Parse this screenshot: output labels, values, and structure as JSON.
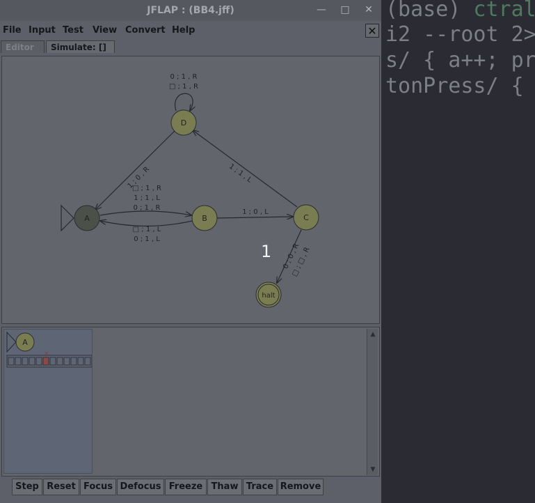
{
  "window": {
    "title": "JFLAP : (BB4.jff)",
    "minimize_glyph": "—",
    "maximize_glyph": "□",
    "close_glyph": "✕"
  },
  "menu": [
    "File",
    "Input",
    "Test",
    "View",
    "Convert",
    "Help"
  ],
  "doc_close_glyph": "✕",
  "tabs": [
    "Editor",
    "Simulate: []"
  ],
  "automaton": {
    "states": {
      "A": "A",
      "B": "B",
      "C": "C",
      "D": "D",
      "halt": "halt"
    },
    "transitions": {
      "d_loop_1": "0 ; 1 , R",
      "d_loop_2": "□ ; 1 , R",
      "a_d": "1 ; 0 , R",
      "c_d": "1 ; 1 , L",
      "a_b_1": "□ ; 1 , R",
      "a_b_2": "1 ; 1 , L",
      "a_b_3": "0 ; 1 , R",
      "b_a_1": "□ ; 1 , L",
      "b_a_2": "0 ; 1 , L",
      "b_c": "1 ; 0 , L",
      "c_halt_1": "0 ; 0 , R",
      "c_halt_2": "□ ; □ , R"
    }
  },
  "simulation": {
    "current_state": "A",
    "tape": [
      "□",
      "□",
      "□",
      "□",
      "□",
      "□",
      "□",
      "□",
      "□",
      "□",
      "□",
      "□"
    ],
    "head_index": 5
  },
  "overlay_number": "1",
  "buttons": [
    "Step",
    "Reset",
    "Focus",
    "Defocus",
    "Freeze",
    "Thaw",
    "Trace",
    "Remove"
  ],
  "terminal": {
    "line1_prefix": "(base)",
    "line1_cmd": " ctral",
    "line2": "i2 --root 2>",
    "line3": "s/ { a++; pr",
    "line4": "tonPress/ {"
  },
  "colors": {
    "state_fill": "#7a7d52",
    "initial_state_fill": "#4b5049",
    "edge": "#26282c"
  }
}
